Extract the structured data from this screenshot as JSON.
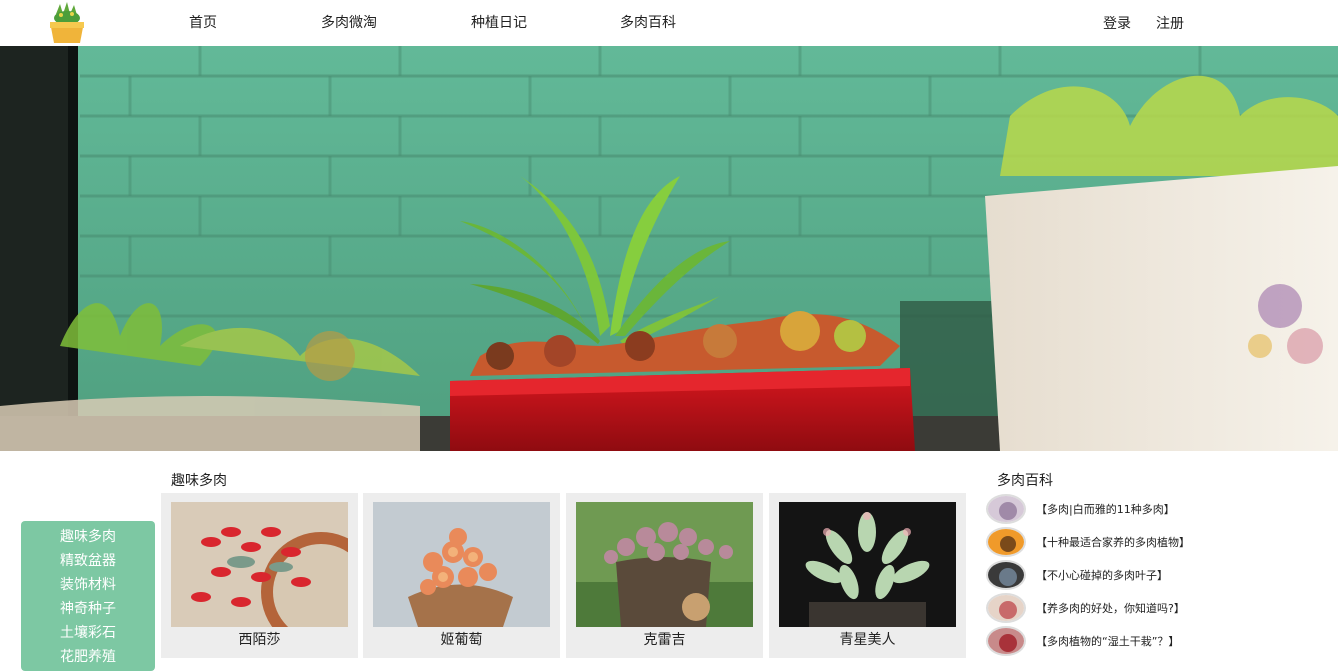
{
  "header": {
    "nav": [
      "首页",
      "多肉微淘",
      "种植日记",
      "多肉百科"
    ],
    "login": "登录",
    "register": "注册"
  },
  "sidebar": {
    "items": [
      "趣味多肉",
      "精致盆器",
      "装饰材料",
      "神奇种子",
      "土壤彩石",
      "花肥养殖"
    ]
  },
  "fun_section": {
    "title": "趣味多肉",
    "cards": [
      {
        "name": "西陌莎",
        "icon": "succulent-photo"
      },
      {
        "name": "姬葡萄",
        "icon": "succulent-photo"
      },
      {
        "name": "克雷吉",
        "icon": "succulent-photo"
      },
      {
        "name": "青星美人",
        "icon": "succulent-photo"
      }
    ]
  },
  "encyclopedia": {
    "title": "多肉百科",
    "items": [
      "【多肉|白而雅的11种多肉】",
      "【十种最适合家养的多肉植物】",
      "【不小心碰掉的多肉叶子】",
      "【养多肉的好处，你知道吗?】",
      "【多肉植物的“湿土干栽”？】"
    ]
  },
  "colors": {
    "sidebar_bg": "#7dc8a3",
    "card_bg": "#ededed",
    "banner_wall": "#6cc4a0",
    "pot_red": "#c0121a"
  }
}
